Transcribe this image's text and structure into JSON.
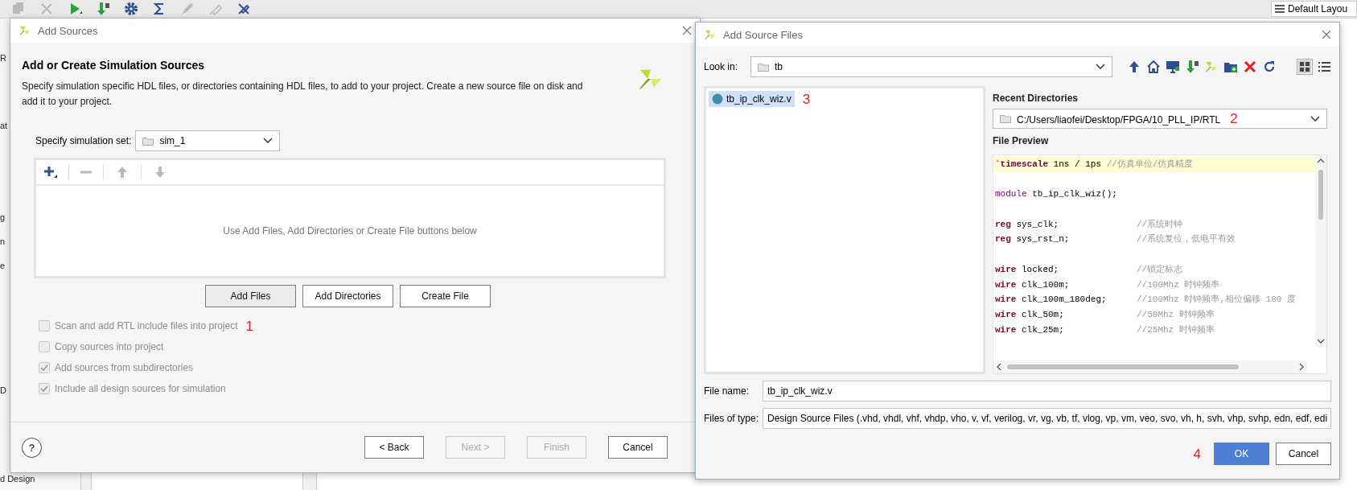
{
  "toolbar": {
    "items": [
      {
        "kind": "copy",
        "disabled": true
      },
      {
        "kind": "close",
        "disabled": true
      },
      {
        "kind": "run",
        "disabled": false
      },
      {
        "kind": "download",
        "disabled": false
      },
      {
        "kind": "settings",
        "disabled": false
      },
      {
        "kind": "sigma",
        "disabled": false
      },
      {
        "kind": "pen",
        "disabled": true
      },
      {
        "kind": "probe",
        "disabled": true
      },
      {
        "kind": "crossed",
        "disabled": false
      }
    ],
    "layout_button": "Default Layou"
  },
  "sidebar": {
    "items": [
      "R",
      "at",
      "g",
      "n",
      "e",
      "D",
      "d Design"
    ]
  },
  "add_sources": {
    "title": "Add Sources",
    "heading": "Add or Create Simulation Sources",
    "description": "Specify simulation specific HDL files, or directories containing HDL files, to add to your project. Create a new source file on disk and add it to your project.",
    "simulation_set": {
      "label": "Specify simulation set:",
      "value": "sim_1"
    },
    "table_tools": [
      {
        "kind": "add",
        "disabled": false
      },
      {
        "kind": "remove",
        "disabled": true
      },
      {
        "kind": "up",
        "disabled": true
      },
      {
        "kind": "down",
        "disabled": true
      }
    ],
    "empty_message": "Use Add Files, Add Directories or Create File buttons below",
    "actions": [
      {
        "label": "Add Files",
        "selected": true
      },
      {
        "label": "Add Directories",
        "selected": false
      },
      {
        "label": "Create File",
        "selected": false
      }
    ],
    "options": [
      {
        "label": "Scan and add RTL include files into project",
        "checked": false,
        "disabled": true,
        "annotation": "1"
      },
      {
        "label": "Copy sources into project",
        "checked": false,
        "disabled": true
      },
      {
        "label": "Add sources from subdirectories",
        "checked": true,
        "disabled": true
      },
      {
        "label": "Include all design sources for simulation",
        "checked": true,
        "disabled": true
      }
    ],
    "help": "?",
    "buttons": [
      {
        "label": "< Back",
        "disabled": false
      },
      {
        "label": "Next >",
        "disabled": true
      },
      {
        "label": "Finish",
        "disabled": true
      },
      {
        "label": "Cancel",
        "disabled": false
      }
    ]
  },
  "add_source_files": {
    "title": "Add Source Files",
    "look_in": {
      "label": "Look in:",
      "value": "tb"
    },
    "nav_tools": [
      {
        "kind": "up",
        "selected": false
      },
      {
        "kind": "home",
        "selected": false
      },
      {
        "kind": "desktop",
        "selected": false
      },
      {
        "kind": "download",
        "selected": false
      },
      {
        "kind": "logo",
        "selected": false
      },
      {
        "kind": "new-folder",
        "selected": false
      },
      {
        "kind": "delete",
        "selected": false
      },
      {
        "kind": "refresh",
        "selected": false
      },
      {
        "kind": "grid",
        "selected": true
      },
      {
        "kind": "list",
        "selected": false
      }
    ],
    "files": [
      {
        "name": "tb_ip_clk_wiz.v",
        "selected": true,
        "annotation": "3"
      }
    ],
    "recent_directories": {
      "label": "Recent Directories",
      "value": "C:/Users/liaofei/Desktop/FPGA/10_PLL_IP/RTL",
      "annotation": "2"
    },
    "file_preview": {
      "label": "File Preview",
      "lines": [
        {
          "kind": "directive",
          "keyword": "`timescale",
          "code": "1ns / 1ps",
          "comment": "//仿真单位/仿真精度",
          "highlighted": true
        },
        {
          "kind": "blank",
          "highlighted": false
        },
        {
          "kind": "module",
          "keyword": "module",
          "code": "tb_ip_clk_wiz();",
          "highlighted": false
        },
        {
          "kind": "blank",
          "highlighted": false
        },
        {
          "kind": "declaration",
          "keyword": "reg",
          "code": "sys_clk;",
          "comment": "//系统时钟",
          "highlighted": false
        },
        {
          "kind": "declaration",
          "keyword": "reg",
          "code": "sys_rst_n;",
          "comment": "//系统复位，低电平有效",
          "highlighted": false
        },
        {
          "kind": "blank",
          "highlighted": false
        },
        {
          "kind": "declaration",
          "keyword": "wire",
          "code": "locked;",
          "comment": "//锁定标志",
          "highlighted": false
        },
        {
          "kind": "declaration",
          "keyword": "wire",
          "code": "clk_100m;",
          "comment": "//100Mhz 时钟频率",
          "highlighted": false
        },
        {
          "kind": "declaration",
          "keyword": "wire",
          "code": "clk_100m_180deg;",
          "comment": "//100Mhz 时钟频率,相位偏移 180 度",
          "highlighted": false
        },
        {
          "kind": "declaration",
          "keyword": "wire",
          "code": "clk_50m;",
          "comment": "//50Mhz 时钟频率",
          "highlighted": false
        },
        {
          "kind": "declaration",
          "keyword": "wire",
          "code": "clk_25m;",
          "comment": "//25Mhz 时钟频率",
          "highlighted": false
        }
      ]
    },
    "file_name": {
      "label": "File name:",
      "value": "tb_ip_clk_wiz.v"
    },
    "files_of_type": {
      "label": "Files of type:",
      "value": "Design Source Files (.vhd, vhdl, vhf, vhdp, vho, v, vf, verilog, vr, vg, vb, tf, vlog, vp, vm, veo, svo, vh, h, svh, vhp, svhp, edn, edf, edi"
    },
    "buttons": [
      {
        "label": "OK",
        "kind": "primary",
        "annotation": "4"
      },
      {
        "label": "Cancel",
        "kind": "normal"
      }
    ]
  }
}
